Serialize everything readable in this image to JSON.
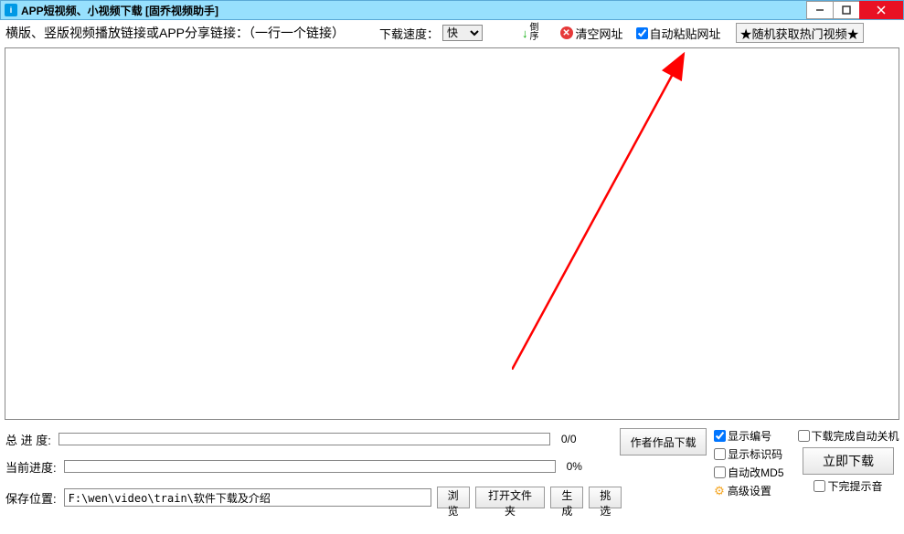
{
  "titlebar": {
    "icon_letter": "i",
    "title": "APP短视频、小视频下载 [固乔视频助手]"
  },
  "toolbar": {
    "link_label": "横版、竖版视频播放链接或APP分享链接：（一行一个链接）",
    "speed_label": "下载速度：",
    "speed_selected": "快",
    "reverse_label": "倒序",
    "clear_label": "清空网址",
    "auto_paste_label": "自动粘贴网址",
    "auto_paste_checked": true,
    "random_label": "★随机获取热门视频★"
  },
  "main": {
    "textarea_value": ""
  },
  "progress": {
    "total_label": "总 进 度:",
    "total_text": "0/0",
    "current_label": "当前进度:",
    "current_text": "0%"
  },
  "save": {
    "label": "保存位置:",
    "path": "F:\\wen\\video\\train\\软件下载及介绍",
    "browse_label": "浏览",
    "open_folder_label": "打开文件夹"
  },
  "buttons": {
    "author_works": "作者作品下载",
    "generate": "生成",
    "pick": "挑选",
    "download_now": "立即下载"
  },
  "checks": {
    "show_number_label": "显示编号",
    "show_number": true,
    "show_code_label": "显示标识码",
    "show_code": false,
    "auto_md5_label": "自动改MD5",
    "auto_md5": false,
    "auto_shutdown_label": "下载完成自动关机",
    "auto_shutdown": false,
    "done_sound_label": "下完提示音",
    "done_sound": false
  },
  "advanced": {
    "label": "高级设置"
  }
}
